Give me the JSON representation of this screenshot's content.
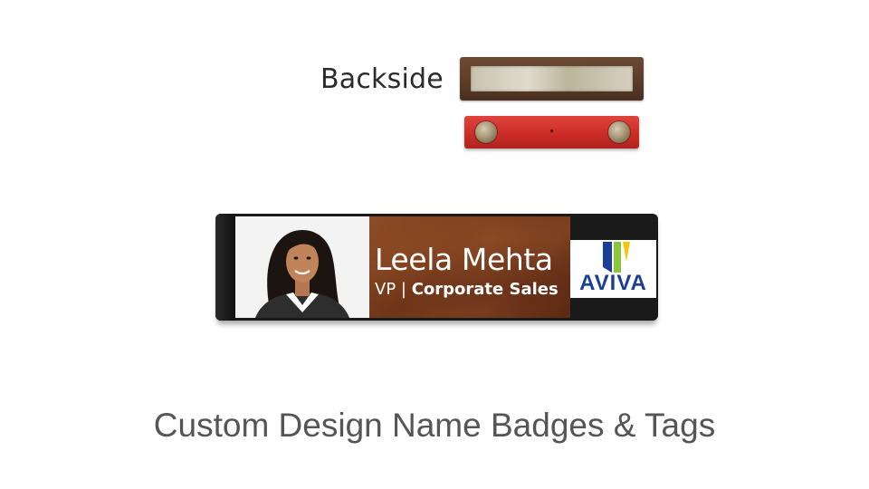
{
  "backside": {
    "label": "Backside"
  },
  "badge": {
    "name": "Leela Mehta",
    "title_prefix": "VP | ",
    "title_main": "Corporate Sales",
    "logo_text": "AVIVA",
    "colors": {
      "logo_blue": "#1b3f94",
      "logo_green": "#8cc63f",
      "logo_yellow": "#f9c20a",
      "wood": "#6e3518"
    }
  },
  "caption": {
    "text": "Custom Design Name Badges & Tags"
  }
}
